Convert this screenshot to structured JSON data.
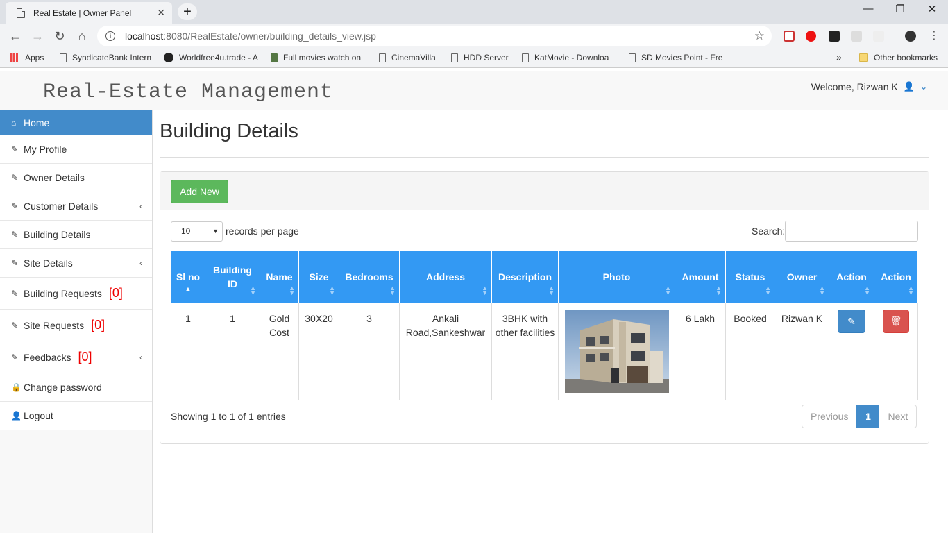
{
  "browser": {
    "tab_title": "Real Estate | Owner Panel",
    "tab_close": "✕",
    "new_tab": "+",
    "url_host": "localhost",
    "url_rest": ":8080/RealEstate/owner/building_details_view.jsp",
    "bookmarks": [
      "Apps",
      "SyndicateBank Intern",
      "Worldfree4u.trade - A",
      "Full movies watch on",
      "CinemaVilla",
      "HDD Server",
      "KatMovie - Downloa",
      "SD Movies Point - Fre"
    ],
    "bookmarks_more": "»",
    "other_bookmarks": "Other bookmarks"
  },
  "app": {
    "brand": "Real-Estate Management",
    "welcome": "Welcome, Rizwan K"
  },
  "sidebar": {
    "items": [
      {
        "label": "Home",
        "icon": "home-icon"
      },
      {
        "label": "My Profile",
        "icon": "edit-icon"
      },
      {
        "label": "Owner Details",
        "icon": "edit-icon"
      },
      {
        "label": "Customer Details",
        "icon": "edit-icon"
      },
      {
        "label": "Building Details",
        "icon": "edit-icon"
      },
      {
        "label": "Site Details",
        "icon": "edit-icon"
      },
      {
        "label": "Building Requests",
        "count": "[0]",
        "icon": "edit-icon"
      },
      {
        "label": "Site Requests",
        "count": "[0]",
        "icon": "edit-icon"
      },
      {
        "label": "Feedbacks",
        "count": "[0]",
        "icon": "edit-icon"
      },
      {
        "label": "Change password",
        "icon": "lock-icon"
      },
      {
        "label": "Logout",
        "icon": "user-icon"
      }
    ]
  },
  "main": {
    "title": "Building Details",
    "add_button": "Add New",
    "length_value": "10",
    "length_text": "records per page",
    "search_label": "Search:",
    "columns": [
      "Sl no",
      "Building ID",
      "Name",
      "Size",
      "Bedrooms",
      "Address",
      "Description",
      "Photo",
      "Amount",
      "Status",
      "Owner",
      "Action",
      "Action"
    ],
    "row": {
      "sl": "1",
      "building_id": "1",
      "name": "Gold Cost",
      "size": "30X20",
      "bedrooms": "3",
      "address": "Ankali Road,Sankeshwar",
      "description": "3BHK with other facilities",
      "amount": "6 Lakh",
      "status": "Booked",
      "owner": "Rizwan K"
    },
    "info": "Showing 1 to 1 of 1 entries",
    "pager": {
      "previous": "Previous",
      "current": "1",
      "next": "Next"
    }
  },
  "colors": {
    "primary": "#428bca",
    "header_blue": "#3399f3",
    "success": "#5cb85c",
    "danger": "#d9534f",
    "count_red": "#ee0000"
  }
}
